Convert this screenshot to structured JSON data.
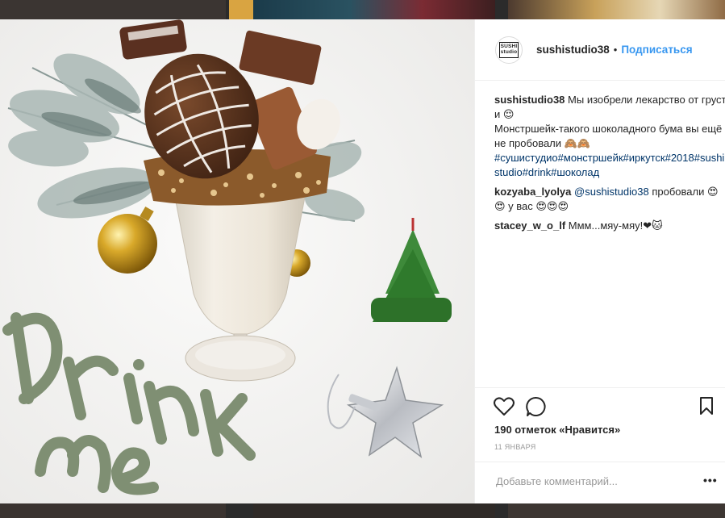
{
  "post": {
    "username": "sushistudio38",
    "separator": "•",
    "follow_label": "Подписаться",
    "avatar_text_line1": "SUSHI",
    "avatar_text_line2": "studio",
    "photo_lettering": "Drink me"
  },
  "caption": {
    "username": "sushistudio38",
    "text_1": " Мы изобрели лекарство от грусти 😌",
    "text_2": "Монстршейк-такого шоколадного бума вы ещё не пробовали 🙈🙈",
    "hashtags": "#сушистудио#монстршейк#иркутск#2018#sushistudio#drink#шоколад"
  },
  "comments": [
    {
      "username": "kozyaba_lyolya",
      "mention": "@sushistudio38",
      "text": " пробовали 😍😍 у вас 😍😍😍"
    },
    {
      "username": "stacey_w_o_lf",
      "text": " Ммм...мяу-мяу!❤🐱"
    }
  ],
  "stats": {
    "likes_label": "190 отметок «Нравится»",
    "date_label": "11 ЯНВАРЯ"
  },
  "composer": {
    "placeholder": "Добавьте комментарий...",
    "more_label": "•••"
  },
  "icons": {
    "like": "heart-icon",
    "comment": "comment-bubble-icon",
    "save": "bookmark-icon"
  },
  "colors": {
    "link_blue": "#3897f0",
    "hashtag": "#003569",
    "lettering_green": "#7f8f73"
  }
}
